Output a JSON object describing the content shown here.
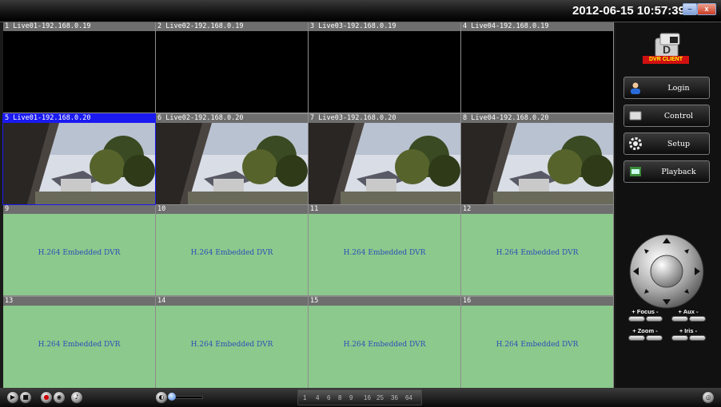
{
  "titlebar": {
    "datetime": "2012-06-15 10:57:39",
    "minimize_glyph": "–",
    "close_glyph": "x"
  },
  "grid": {
    "cells": [
      {
        "index": 1,
        "label": "1 Live01-192.168.0.19",
        "state": "black"
      },
      {
        "index": 2,
        "label": "2 Live02-192.168.0.19",
        "state": "black"
      },
      {
        "index": 3,
        "label": "3 Live03-192.168.0.19",
        "state": "black"
      },
      {
        "index": 4,
        "label": "4 Live04-192.168.0.19",
        "state": "black"
      },
      {
        "index": 5,
        "label": "5 Live01-192.168.0.20",
        "state": "video",
        "active": true
      },
      {
        "index": 6,
        "label": "6 Live02-192.168.0.20",
        "state": "video"
      },
      {
        "index": 7,
        "label": "7 Live03-192.168.0.20",
        "state": "video"
      },
      {
        "index": 8,
        "label": "8 Live04-192.168.0.20",
        "state": "video"
      },
      {
        "index": 9,
        "label": "9",
        "state": "idle"
      },
      {
        "index": 10,
        "label": "10",
        "state": "idle"
      },
      {
        "index": 11,
        "label": "11",
        "state": "idle"
      },
      {
        "index": 12,
        "label": "12",
        "state": "idle"
      },
      {
        "index": 13,
        "label": "13",
        "state": "idle"
      },
      {
        "index": 14,
        "label": "14",
        "state": "idle"
      },
      {
        "index": 15,
        "label": "15",
        "state": "idle"
      },
      {
        "index": 16,
        "label": "16",
        "state": "idle"
      }
    ],
    "idle_text": "H.264 Embedded DVR"
  },
  "sidebar": {
    "logo_text": "DVR CLIENT",
    "buttons": [
      {
        "label": "Login",
        "icon": "user-icon"
      },
      {
        "label": "Control",
        "icon": "monitor-icon"
      },
      {
        "label": "Setup",
        "icon": "gear-icon"
      },
      {
        "label": "Playback",
        "icon": "film-icon"
      }
    ],
    "controls": {
      "focus": "+ Focus -",
      "aux": "+ Aux -",
      "zoom": "+ Zoom -",
      "iris": "+ Iris -"
    }
  },
  "bottombar": {
    "split_options": [
      "1",
      "4",
      "6",
      "8",
      "9",
      "16",
      "25",
      "36",
      "64"
    ]
  },
  "colors": {
    "active_header": "#1a1af0",
    "idle_cell": "#8cc98c",
    "idle_text": "#2a4fb8"
  }
}
